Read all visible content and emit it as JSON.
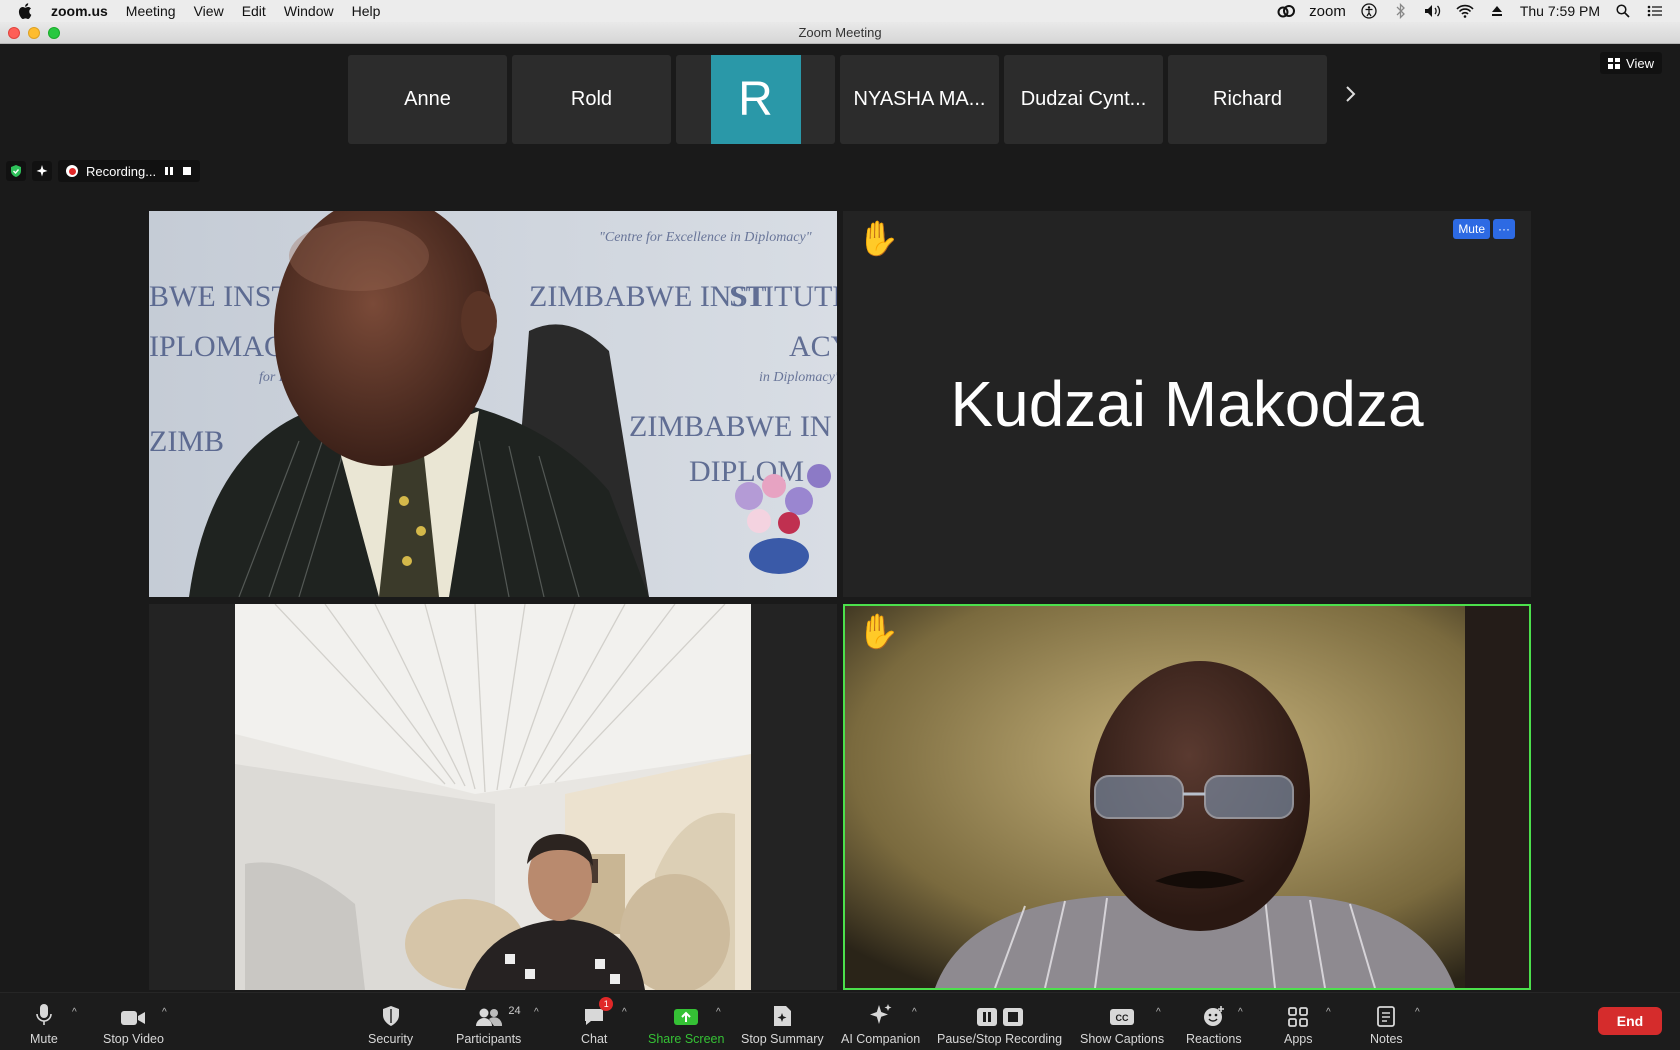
{
  "menubar": {
    "app_name": "zoom.us",
    "items": [
      "Meeting",
      "View",
      "Edit",
      "Window",
      "Help"
    ],
    "status_app": "zoom",
    "clock": "Thu 7:59 PM"
  },
  "window": {
    "title": "Zoom Meeting"
  },
  "view_button": "View",
  "strip": {
    "tiles": [
      "Anne",
      "Rold",
      "R",
      "NYASHA MA...",
      "Dudzai Cynt...",
      "Richard"
    ],
    "avatar_color": "#2a98a8"
  },
  "recording": {
    "label": "Recording..."
  },
  "tiles": {
    "named_participant": "Kudzai Makodza",
    "mute_label": "Mute",
    "more_label": "···",
    "hand_icon": "raised-hand-icon",
    "active_border_color": "#4ce04c"
  },
  "toolbar": {
    "mute": "Mute",
    "stop_video": "Stop Video",
    "security": "Security",
    "participants": "Participants",
    "participants_count": "24",
    "chat": "Chat",
    "chat_badge": "1",
    "share_screen": "Share Screen",
    "stop_summary": "Stop Summary",
    "ai_companion": "AI Companion",
    "pause_stop_recording": "Pause/Stop Recording",
    "show_captions": "Show Captions",
    "reactions": "Reactions",
    "apps": "Apps",
    "notes": "Notes",
    "end": "End",
    "share_color": "#35c135",
    "end_color": "#d52c2c"
  }
}
